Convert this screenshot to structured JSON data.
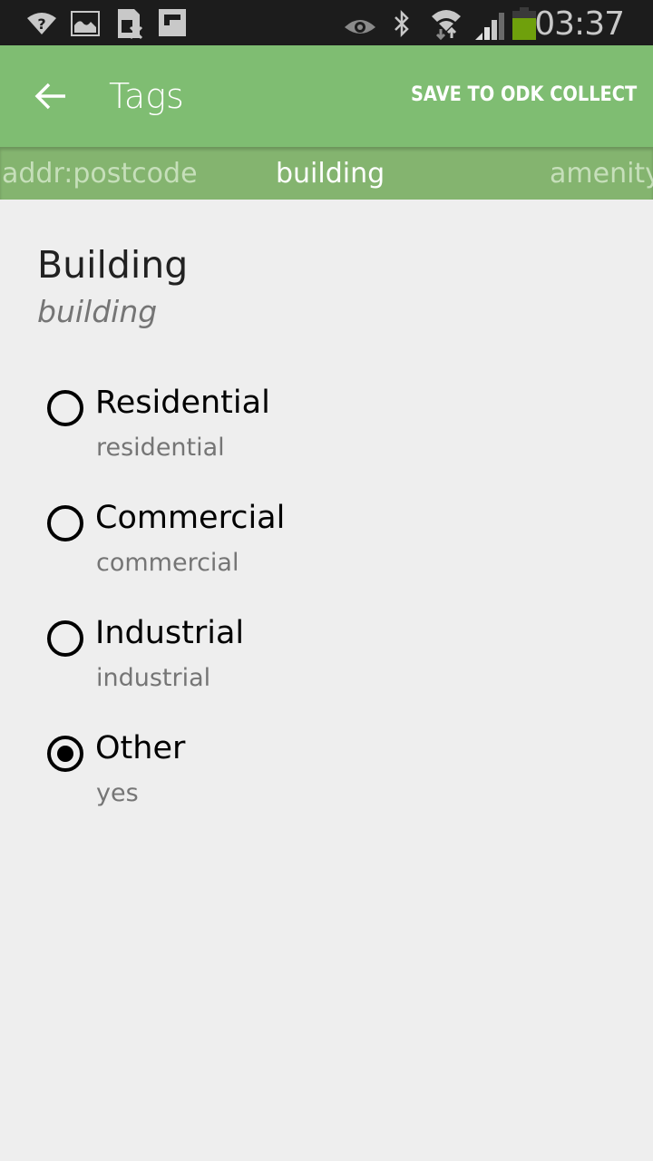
{
  "status_bar": {
    "time": "03:37",
    "icons": [
      "wifi-unknown-icon",
      "image-icon",
      "sim-error-icon",
      "flipboard-icon",
      "eye-icon",
      "bluetooth-icon",
      "wifi-data-icon",
      "signal-icon",
      "battery-icon"
    ],
    "battery_color": "#6fa00c"
  },
  "toolbar": {
    "title": "Tags",
    "back_icon": "arrow-left-icon",
    "save_label": "SAVE TO ODK COLLECT",
    "color": "#7fbd72"
  },
  "tabs": [
    {
      "label": "addr:postcode",
      "active": false
    },
    {
      "label": "building",
      "active": true
    },
    {
      "label": "amenity",
      "active": false
    }
  ],
  "question": {
    "title": "Building",
    "key": "building"
  },
  "options": [
    {
      "label": "Residential",
      "value": "residential",
      "selected": false
    },
    {
      "label": "Commercial",
      "value": "commercial",
      "selected": false
    },
    {
      "label": "Industrial",
      "value": "industrial",
      "selected": false
    },
    {
      "label": "Other",
      "value": "yes",
      "selected": true
    }
  ]
}
